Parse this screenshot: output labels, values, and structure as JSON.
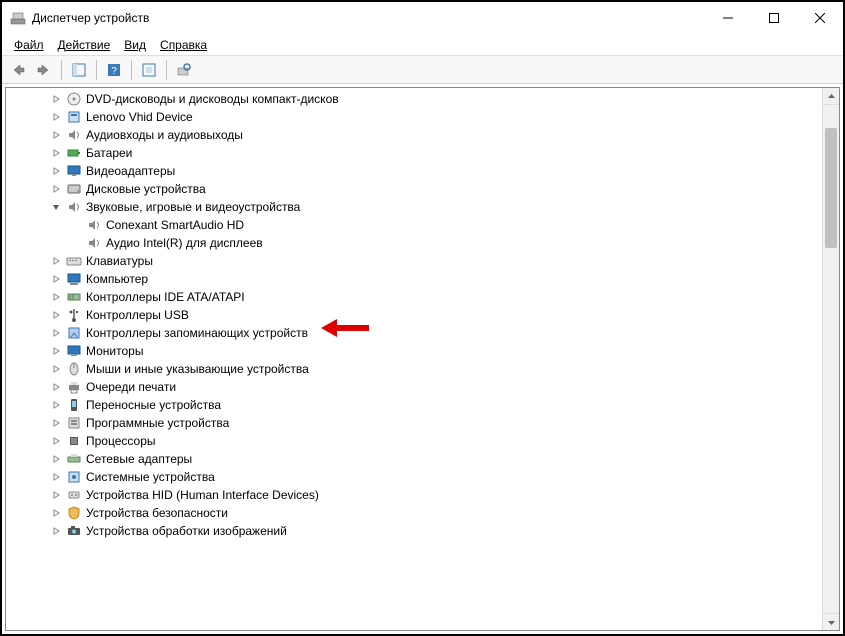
{
  "title": "Диспетчер устройств",
  "menu": {
    "file": "Файл",
    "action": "Действие",
    "view": "Вид",
    "help": "Справка"
  },
  "tree": [
    {
      "label": "DVD-дисководы и дисководы компакт-дисков",
      "icon": "disc",
      "expanded": false,
      "children": []
    },
    {
      "label": "Lenovo Vhid Device",
      "icon": "device",
      "expanded": false,
      "children": []
    },
    {
      "label": "Аудиовходы и аудиовыходы",
      "icon": "audio",
      "expanded": false,
      "children": []
    },
    {
      "label": "Батареи",
      "icon": "battery",
      "expanded": false,
      "children": []
    },
    {
      "label": "Видеоадаптеры",
      "icon": "display",
      "expanded": false,
      "children": []
    },
    {
      "label": "Дисковые устройства",
      "icon": "hdd",
      "expanded": false,
      "children": []
    },
    {
      "label": "Звуковые, игровые и видеоустройства",
      "icon": "audio",
      "expanded": true,
      "children": [
        {
          "label": "Conexant SmartAudio HD",
          "icon": "audio"
        },
        {
          "label": "Аудио Intel(R) для дисплеев",
          "icon": "audio"
        }
      ]
    },
    {
      "label": "Клавиатуры",
      "icon": "keyboard",
      "expanded": false,
      "children": []
    },
    {
      "label": "Компьютер",
      "icon": "computer",
      "expanded": false,
      "children": []
    },
    {
      "label": "Контроллеры IDE ATA/ATAPI",
      "icon": "controller",
      "expanded": false,
      "children": []
    },
    {
      "label": "Контроллеры USB",
      "icon": "usb",
      "expanded": false,
      "children": []
    },
    {
      "label": "Контроллеры запоминающих устройств",
      "icon": "storage",
      "expanded": false,
      "children": []
    },
    {
      "label": "Мониторы",
      "icon": "monitor",
      "expanded": false,
      "children": []
    },
    {
      "label": "Мыши и иные указывающие устройства",
      "icon": "mouse",
      "expanded": false,
      "children": []
    },
    {
      "label": "Очереди печати",
      "icon": "printer",
      "expanded": false,
      "children": []
    },
    {
      "label": "Переносные устройства",
      "icon": "portable",
      "expanded": false,
      "children": []
    },
    {
      "label": "Программные устройства",
      "icon": "software",
      "expanded": false,
      "children": []
    },
    {
      "label": "Процессоры",
      "icon": "cpu",
      "expanded": false,
      "children": []
    },
    {
      "label": "Сетевые адаптеры",
      "icon": "network",
      "expanded": false,
      "children": []
    },
    {
      "label": "Системные устройства",
      "icon": "system",
      "expanded": false,
      "children": []
    },
    {
      "label": "Устройства HID (Human Interface Devices)",
      "icon": "hid",
      "expanded": false,
      "children": []
    },
    {
      "label": "Устройства безопасности",
      "icon": "security",
      "expanded": false,
      "children": []
    },
    {
      "label": "Устройства обработки изображений",
      "icon": "imaging",
      "expanded": false,
      "children": []
    }
  ]
}
